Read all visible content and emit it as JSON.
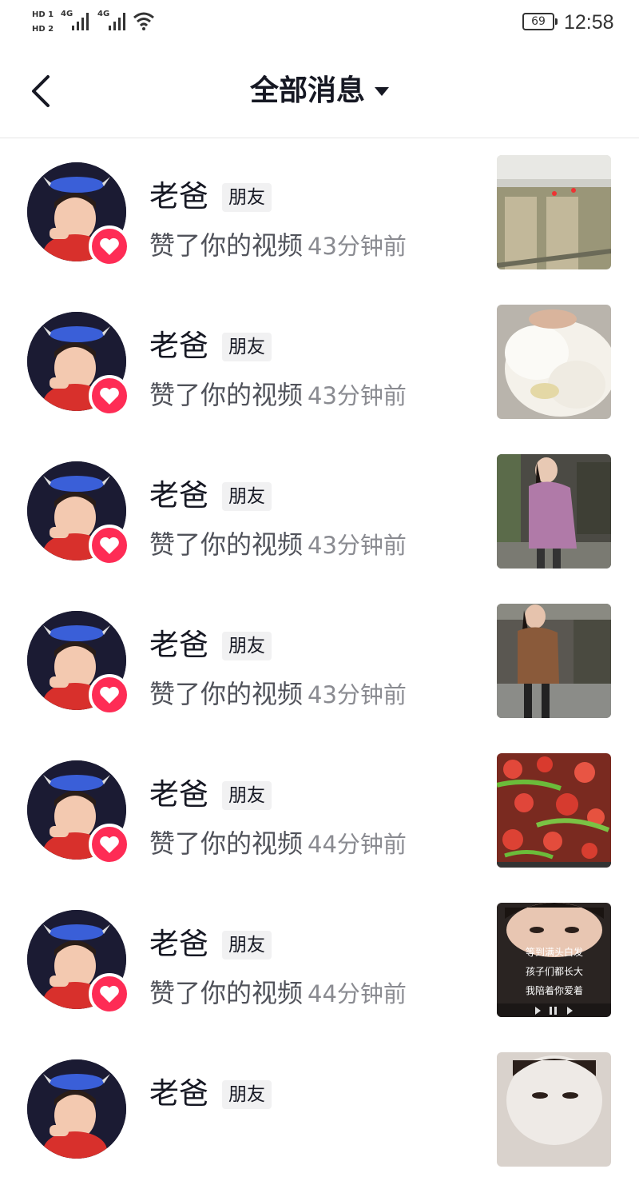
{
  "status_bar": {
    "sim1": "HD 1",
    "sim2": "HD 2",
    "network1": "4G",
    "network2": "4G",
    "battery": "69",
    "time": "12:58"
  },
  "header": {
    "title": "全部消息"
  },
  "notifications": [
    {
      "name": "老爸",
      "tag": "朋友",
      "action": "赞了你的视频",
      "time": "43分钟前",
      "thumb": "storefront-shutters"
    },
    {
      "name": "老爸",
      "tag": "朋友",
      "action": "赞了你的视频",
      "time": "43分钟前",
      "thumb": "white-fleece"
    },
    {
      "name": "老爸",
      "tag": "朋友",
      "action": "赞了你的视频",
      "time": "43分钟前",
      "thumb": "pink-coat-shop"
    },
    {
      "name": "老爸",
      "tag": "朋友",
      "action": "赞了你的视频",
      "time": "43分钟前",
      "thumb": "brown-coat-shop"
    },
    {
      "name": "老爸",
      "tag": "朋友",
      "action": "赞了你的视频",
      "time": "44分钟前",
      "thumb": "tomato-pepper-dish"
    },
    {
      "name": "老爸",
      "tag": "朋友",
      "action": "赞了你的视频",
      "time": "44分钟前",
      "thumb": "selfie-with-lyrics",
      "thumb_lyrics": [
        "等到满头白发",
        "孩子们都长大",
        "我陪着你爱着"
      ]
    },
    {
      "name": "老爸",
      "tag": "朋友",
      "action": "",
      "time": "",
      "thumb": "face-mask-selfie"
    }
  ]
}
